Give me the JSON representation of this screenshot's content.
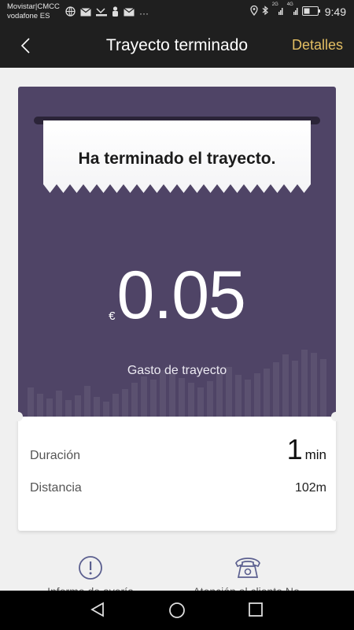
{
  "status_bar": {
    "carrier_1": "Movistar|CMCC",
    "carrier_2": "vodafone ES",
    "network_label_1": "2G",
    "network_label_2": "4G",
    "battery_icon": "battery-icon",
    "time": "9:49",
    "more": "···"
  },
  "app_bar": {
    "title": "Trayecto terminado",
    "details_label": "Detalles",
    "details_color": "#e4bf63"
  },
  "receipt": {
    "message": "Ha terminado el trayecto."
  },
  "trip_cost": {
    "currency": "€",
    "amount": "0.05",
    "label": "Gasto de trayecto",
    "card_color": "#4f4466"
  },
  "stats": {
    "duration_label": "Duración",
    "duration_value": "1",
    "duration_unit": "min",
    "distance_label": "Distancia",
    "distance_value": "102m"
  },
  "actions": {
    "left_label": "Informe de avería",
    "left_icon": "alert-circle-icon",
    "right_label": "Atención al cliente No.",
    "right_icon": "telephone-icon"
  }
}
